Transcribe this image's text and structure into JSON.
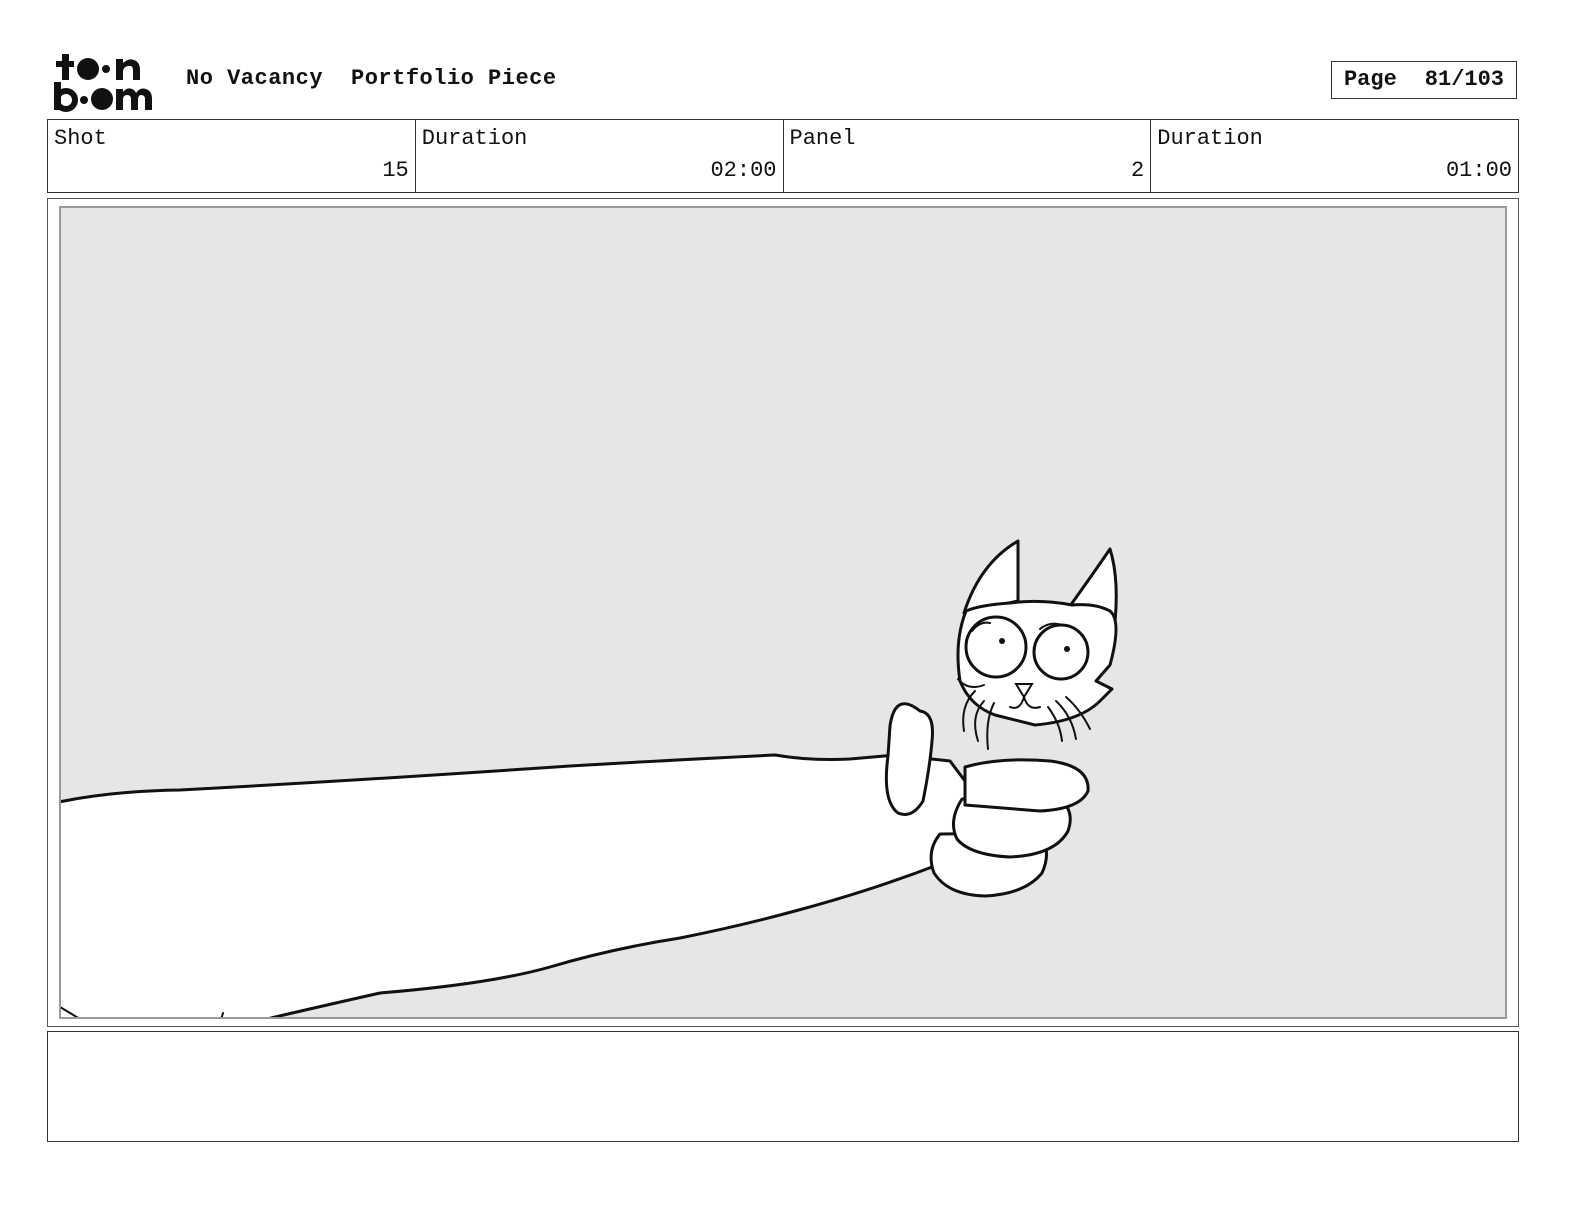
{
  "header": {
    "logo_text_top": "toon",
    "logo_text_bottom": "boom",
    "project_title": "No Vacancy",
    "subtitle": "Portfolio Piece",
    "page_label": "Page",
    "page_number": "81/103"
  },
  "shot_info": [
    {
      "label": "Shot",
      "value": "15"
    },
    {
      "label": "Duration",
      "value": "02:00"
    },
    {
      "label": "Panel",
      "value": "2"
    },
    {
      "label": "Duration",
      "value": "01:00"
    }
  ],
  "panel": {
    "background_color": "#e6e6e6",
    "drawing": "cat-on-outstretched-arm-sketch"
  },
  "notes": {
    "text": ""
  }
}
